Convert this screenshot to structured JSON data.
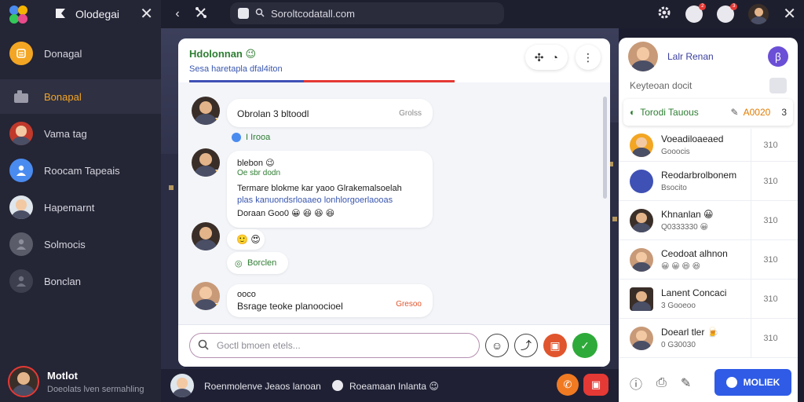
{
  "sidebar": {
    "title": "Olodegai",
    "items": [
      {
        "label": "Donagal",
        "icon": "list-icon"
      },
      {
        "label": "Bonapal",
        "icon": "folder-icon",
        "active": true
      },
      {
        "label": "Vama tag",
        "icon": "avatar"
      },
      {
        "label": "Roocam Tapeais",
        "icon": "person-icon"
      },
      {
        "label": "Hapemarnt",
        "icon": "avatar"
      },
      {
        "label": "Solmocis",
        "icon": "person-icon"
      },
      {
        "label": "Bonclan",
        "icon": "person-icon"
      }
    ],
    "user": {
      "name": "Motlot",
      "subtitle": "Doeolats lven sermahling"
    }
  },
  "topbar": {
    "url": "Soroltcodatall.com",
    "notifications": [
      {
        "count": "2"
      },
      {
        "count": "3"
      }
    ]
  },
  "chat": {
    "title": "Hdolonnan 😉",
    "subtitle": "Sesa haretapla dfal4iton",
    "tab_colors": [
      "#3f51b5",
      "#e53935"
    ],
    "messages": [
      {
        "name": "",
        "text": "Obrolan 3 bltoodl",
        "meta": "Grolss"
      },
      {
        "text": "I Irooa"
      },
      {
        "name": "blebon 😉",
        "handle": "Oe sbr dodn",
        "text1": "Termare blokme kar yaoo Glrakemalsoelah",
        "text2": "plas kanuondsrloaaeo lonhlorgoerlaooas",
        "text3": "Doraan Goo0 😀 😆 😆 😆"
      },
      {
        "text": "🙂 😍"
      },
      {
        "text": "Borclen"
      },
      {
        "name": "ooco",
        "text": "Bsrage teoke planoocioel",
        "meta": "Gresoo"
      }
    ],
    "composer": {
      "placeholder": "Goctl bmoen etels..."
    }
  },
  "bottom": {
    "left_text": "Roenmolenve Jeaos lanoan",
    "right_text": "Roeamaan Inlanta 😉"
  },
  "rpanel": {
    "name": "Lalr Renan",
    "subline": "Keyteoan docit",
    "ticket": {
      "left": "Torodi Tauous",
      "code": "A0020",
      "right": "3"
    },
    "rows": [
      {
        "name": "Voeadiloaeaed",
        "sub": "Gooocis",
        "time": "310"
      },
      {
        "name": "Reodarbrolbonem",
        "sub": "Bsocito",
        "time": "310"
      },
      {
        "name": "Khnanlan 😀",
        "sub": "Q0333330 😀",
        "time": "310"
      },
      {
        "name": "Ceodoat alhnon",
        "sub": "😀 😀 😆 😆",
        "time": "310"
      },
      {
        "name": "Lanent Concaci",
        "sub": "3 Gooeoo",
        "time": "310"
      },
      {
        "name": "Doearl tler 🍺",
        "sub": "0 G30030",
        "time": "310"
      }
    ],
    "cta": "MOLIEK"
  }
}
